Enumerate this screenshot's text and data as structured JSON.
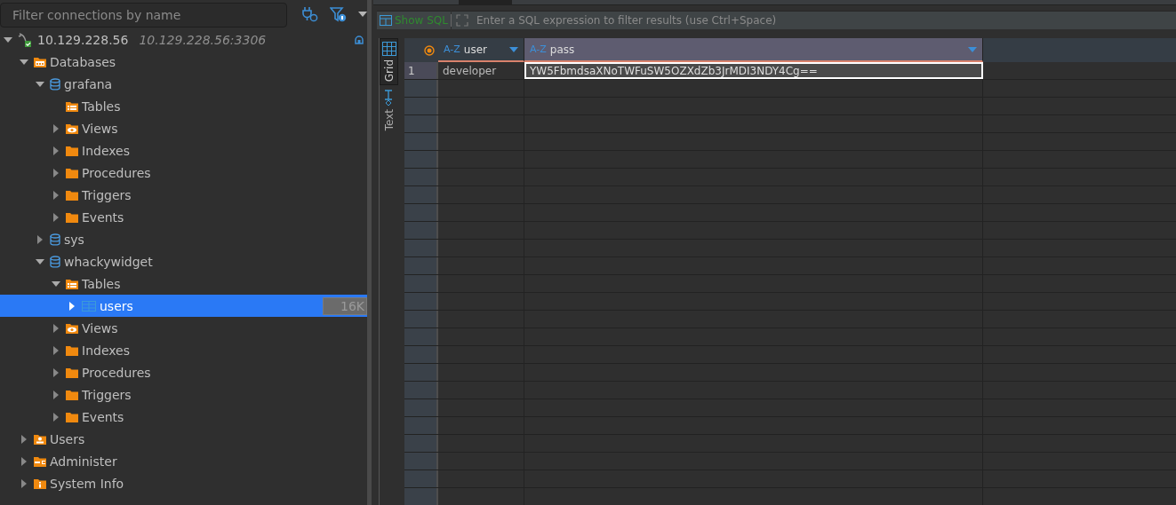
{
  "navigator": {
    "search": {
      "placeholder": "Filter connections by name"
    },
    "tree": [
      {
        "label": "10.129.228.56",
        "detail": "10.129.228.56:3306",
        "kind": "connection",
        "expanded": true,
        "selected": false,
        "children": [
          {
            "label": "Databases",
            "kind": "databases",
            "expanded": true,
            "selected": false,
            "children": [
              {
                "label": "grafana",
                "kind": "database",
                "expanded": true,
                "selected": false,
                "children": [
                  {
                    "label": "Tables",
                    "kind": "tables",
                    "selected": false
                  },
                  {
                    "label": "Views",
                    "kind": "views",
                    "expanded": false,
                    "selected": false
                  },
                  {
                    "label": "Indexes",
                    "kind": "folder",
                    "expanded": false,
                    "selected": false
                  },
                  {
                    "label": "Procedures",
                    "kind": "folder",
                    "expanded": false,
                    "selected": false
                  },
                  {
                    "label": "Triggers",
                    "kind": "folder",
                    "expanded": false,
                    "selected": false
                  },
                  {
                    "label": "Events",
                    "kind": "folder",
                    "expanded": false,
                    "selected": false
                  }
                ]
              },
              {
                "label": "sys",
                "kind": "database",
                "expanded": false,
                "selected": false
              },
              {
                "label": "whackywidget",
                "kind": "database",
                "expanded": true,
                "selected": false,
                "children": [
                  {
                    "label": "Tables",
                    "kind": "tables",
                    "expanded": true,
                    "selected": false,
                    "children": [
                      {
                        "label": "users",
                        "kind": "table",
                        "expanded": false,
                        "selected": true,
                        "badge": "16K"
                      }
                    ]
                  },
                  {
                    "label": "Views",
                    "kind": "views",
                    "expanded": false,
                    "selected": false
                  },
                  {
                    "label": "Indexes",
                    "kind": "folder",
                    "expanded": false,
                    "selected": false
                  },
                  {
                    "label": "Procedures",
                    "kind": "folder",
                    "expanded": false,
                    "selected": false
                  },
                  {
                    "label": "Triggers",
                    "kind": "folder",
                    "expanded": false,
                    "selected": false
                  },
                  {
                    "label": "Events",
                    "kind": "folder",
                    "expanded": false,
                    "selected": false
                  }
                ]
              }
            ]
          },
          {
            "label": "Users",
            "kind": "users",
            "expanded": false,
            "selected": false
          },
          {
            "label": "Administer",
            "kind": "admin",
            "expanded": false,
            "selected": false
          },
          {
            "label": "System Info",
            "kind": "info",
            "expanded": false,
            "selected": false
          }
        ]
      }
    ]
  },
  "results": {
    "filter": {
      "show_sql": "Show SQL",
      "placeholder": "Enter a SQL expression to filter results (use Ctrl+Space)"
    },
    "view_tabs": [
      {
        "label": "Grid",
        "kind": "grid",
        "selected": true
      },
      {
        "label": "Text",
        "kind": "text",
        "selected": false
      }
    ],
    "table": {
      "columns": [
        {
          "type": "A-Z",
          "name": "user",
          "selected": false
        },
        {
          "type": "A-Z",
          "name": "pass",
          "selected": true
        }
      ],
      "rows": [
        {
          "number": "1",
          "cells": [
            {
              "value": "developer",
              "selected": false
            },
            {
              "value": "YW5FbmdsaXNoTWFuSW5OZXdZb3JrMDI3NDY4Cg==",
              "selected": true
            }
          ]
        }
      ]
    }
  }
}
